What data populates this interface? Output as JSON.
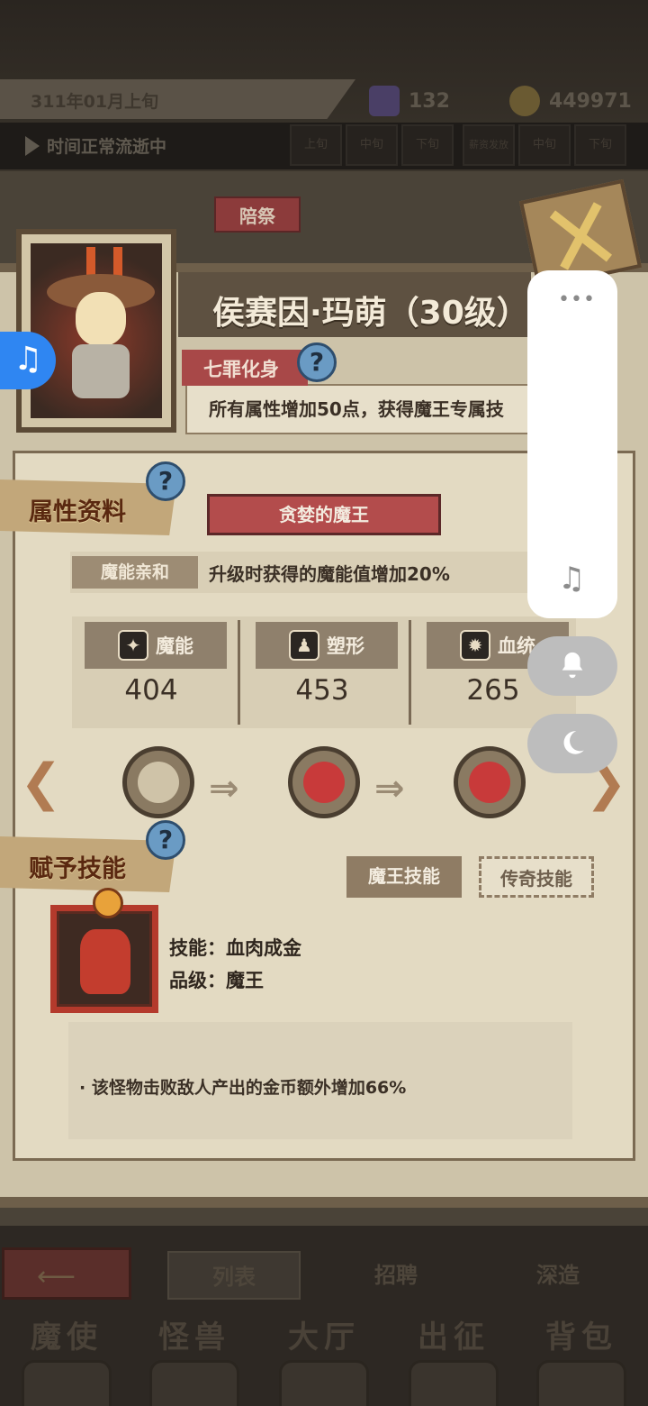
{
  "top": {
    "date": "311年01月上旬",
    "crystals": "132",
    "gold": "449971",
    "time_status": "时间正常流逝中",
    "slots": [
      "上旬",
      "中旬",
      "下旬",
      "薪资发放",
      "中旬",
      "下旬"
    ]
  },
  "hero": {
    "tag": "陪祭",
    "name": "侯赛因·玛萌（30级）",
    "trait_title": "七罪化身",
    "trait_desc": "所有属性增加50点，获得魔王专属技"
  },
  "attributes": {
    "section_label": "属性资料",
    "title": "贪婪的魔王",
    "affinity_label": "魔能亲和",
    "affinity_text": "升级时获得的魔能值增加20%",
    "stats": [
      {
        "label": "魔能",
        "value": "404",
        "icon": "demon-energy-icon"
      },
      {
        "label": "塑形",
        "value": "453",
        "icon": "shaping-icon"
      },
      {
        "label": "血统",
        "value": "265",
        "icon": "bloodline-icon"
      }
    ]
  },
  "skills": {
    "section_label": "赋予技能",
    "tab_demon": "魔王技能",
    "tab_legend": "传奇技能",
    "skill_name": "技能：血肉成金",
    "skill_grade": "品级：魔王",
    "skill_desc": "·   该怪物击败敌人产出的金币额外增加66%"
  },
  "bottom": {
    "subtabs": [
      "列表",
      "招聘",
      "深造"
    ],
    "nav": [
      "魔使",
      "怪兽",
      "大厅",
      "出征",
      "背包"
    ]
  },
  "icons": {
    "help": "?",
    "music": "♫",
    "bell": "bell-icon",
    "moon": "moon-icon"
  }
}
